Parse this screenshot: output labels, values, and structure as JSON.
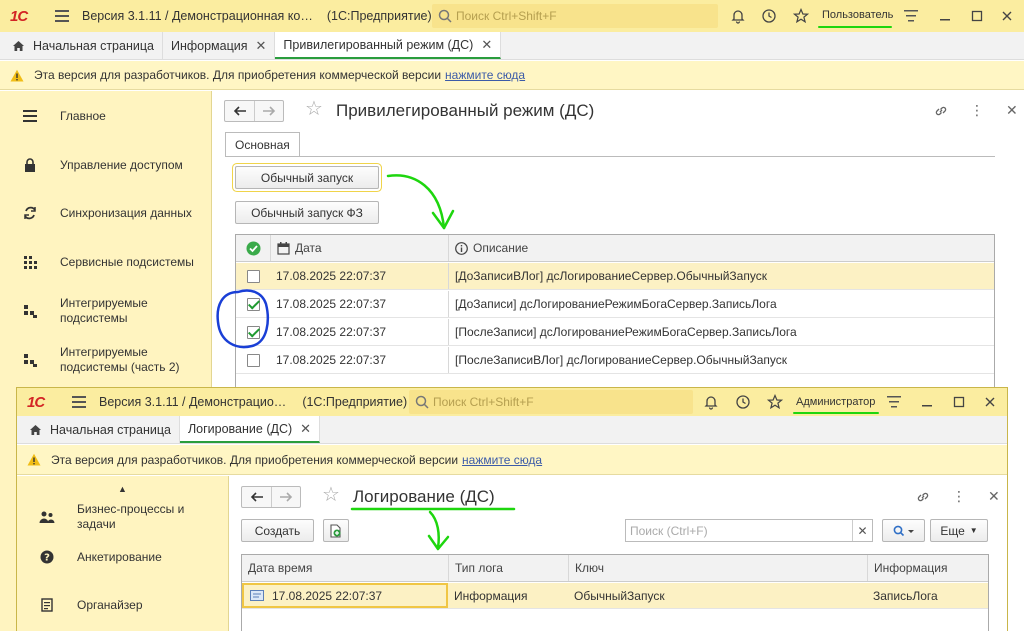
{
  "colors": {
    "titlebar_bg": "#fbeda0",
    "sidebar_bg": "#fff4c0",
    "warning_bg": "#fff6c4",
    "accent_green": "#2a9d3d",
    "annotation_green": "#1ed60e",
    "annotation_blue": "#1a3fd6",
    "selected_row": "#fcf1c4",
    "logo_red": "#d32525"
  },
  "window_user": {
    "logo": "1С",
    "title": "Версия 3.1.11 / Демонстрационная ко…",
    "app_name": "(1С:Предприятие)",
    "search_placeholder": "Поиск Ctrl+Shift+F",
    "user_name": "Пользователь",
    "tabs": [
      {
        "label": "Начальная страница"
      },
      {
        "label": "Информация"
      },
      {
        "label": "Привилегированный режим (ДС)"
      }
    ],
    "warning": {
      "text": "Эта версия для разработчиков. Для приобретения коммерческой версии",
      "link": "нажмите сюда"
    },
    "sidebar": [
      {
        "label": "Главное",
        "icon": "list-icon"
      },
      {
        "label": "Управление доступом",
        "icon": "lock-icon"
      },
      {
        "label": "Синхронизация данных",
        "icon": "sync-icon"
      },
      {
        "label": "Сервисные подсистемы",
        "icon": "grid-icon"
      },
      {
        "label": "Интегрируемые подсистемы",
        "icon": "blocks-icon"
      },
      {
        "label": "Интегрируемые подсистемы (часть 2)",
        "icon": "blocks-icon"
      }
    ],
    "form": {
      "title": "Привилегированный режим (ДС)",
      "page_tab": "Основная",
      "btn_run": "Обычный запуск",
      "btn_run_fz": "Обычный запуск ФЗ",
      "columns": [
        "Дата",
        "Описание"
      ],
      "rows": [
        {
          "checked": false,
          "date": "17.08.2025 22:07:37",
          "desc": "[ДоЗаписиВЛог] дсЛогированиеСервер.ОбычныйЗапуск"
        },
        {
          "checked": true,
          "date": "17.08.2025 22:07:37",
          "desc": "[ДоЗаписи] дсЛогированиеРежимБогаСервер.ЗаписьЛога"
        },
        {
          "checked": true,
          "date": "17.08.2025 22:07:37",
          "desc": "[ПослеЗаписи] дсЛогированиеРежимБогаСервер.ЗаписьЛога"
        },
        {
          "checked": false,
          "date": "17.08.2025 22:07:37",
          "desc": "[ПослеЗаписиВЛог] дсЛогированиеСервер.ОбычныйЗапуск"
        }
      ]
    }
  },
  "window_admin": {
    "logo": "1С",
    "title": "Версия 3.1.11 / Демонстрацио…",
    "app_name": "(1С:Предприятие)",
    "search_placeholder": "Поиск Ctrl+Shift+F",
    "user_name": "Администратор",
    "tabs": [
      {
        "label": "Начальная страница"
      },
      {
        "label": "Логирование (ДС)"
      }
    ],
    "warning": {
      "text": "Эта версия для разработчиков. Для приобретения коммерческой версии",
      "link": "нажмите сюда"
    },
    "sidebar": [
      {
        "label": "Бизнес-процессы и задачи",
        "icon": "people-icon"
      },
      {
        "label": "Анкетирование",
        "icon": "question-icon"
      },
      {
        "label": "Органайзер",
        "icon": "notebook-icon"
      }
    ],
    "form": {
      "title": "Логирование (ДС)",
      "btn_create": "Создать",
      "search_placeholder": "Поиск (Ctrl+F)",
      "btn_more": "Еще",
      "columns": [
        "Дата время",
        "Тип лога",
        "Ключ",
        "Информация"
      ],
      "rows": [
        {
          "datetime": "17.08.2025 22:07:37",
          "type": "Информация",
          "key": "ОбычныйЗапуск",
          "info": "ЗаписьЛога"
        }
      ]
    }
  }
}
